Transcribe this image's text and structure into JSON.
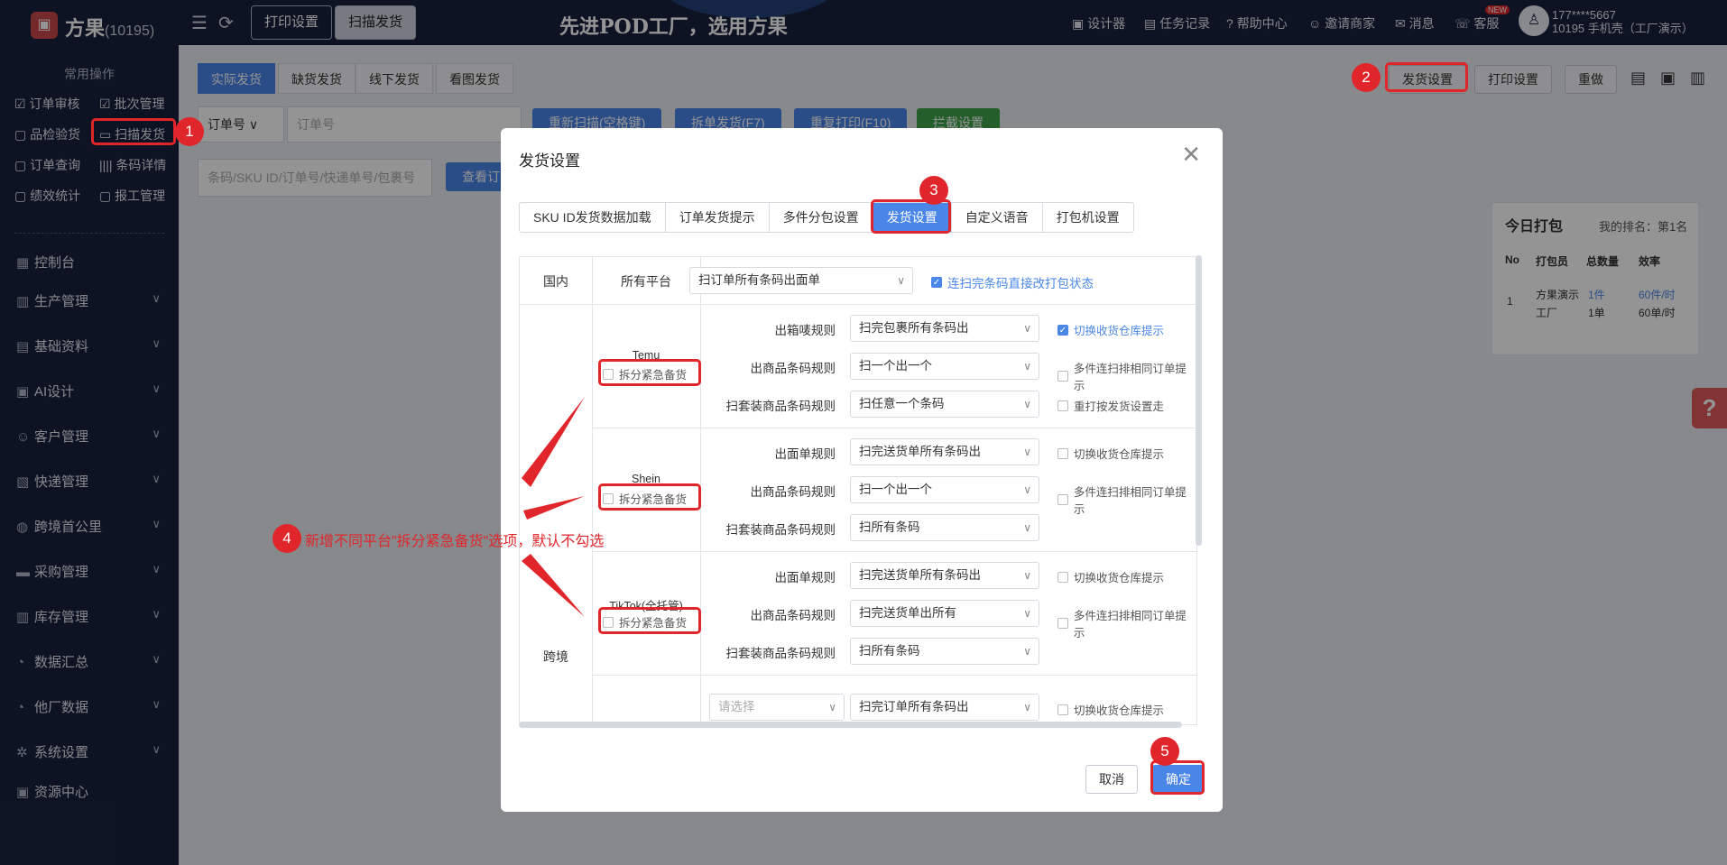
{
  "app": {
    "name": "方果",
    "id": "(10195)",
    "slogan": "先进POD工厂，选用方果"
  },
  "topbar": {
    "print_settings": "打印设置",
    "scan_ship": "扫描发货",
    "links": [
      "设计器",
      "任务记录",
      "帮助中心",
      "邀请商家",
      "消息",
      "客服"
    ],
    "new_badge": "NEW",
    "user_phone": "177****5667",
    "user_sub": "10195 手机壳（工厂演示）"
  },
  "sidebar": {
    "title": "常用操作",
    "quick": [
      "订单审核",
      "批次管理",
      "品检验货",
      "扫描发货",
      "订单查询",
      "条码详情",
      "绩效统计",
      "报工管理"
    ],
    "menu": [
      "控制台",
      "生产管理",
      "基础资料",
      "AI设计",
      "客户管理",
      "快递管理",
      "跨境首公里",
      "采购管理",
      "库存管理",
      "数据汇总",
      "他厂数据",
      "系统设置",
      "资源中心"
    ]
  },
  "subtabs": [
    "实际发货",
    "缺货发货",
    "线下发货",
    "看图发货"
  ],
  "right_buttons": [
    "发货设置",
    "打印设置",
    "重做"
  ],
  "search": {
    "order_type": "订单号",
    "order_ph": "订单号",
    "barcode_ph": "条码/SKU ID/订单号/快递单号/包裹号",
    "view_btn": "查看订"
  },
  "actions": [
    "重新扫描(空格键)",
    "拆单发货(F7)",
    "重复打印(F10)",
    "拦截设置"
  ],
  "panel": {
    "title": "今日打包",
    "rank": "我的排名：第1名",
    "headers": [
      "No",
      "打包员",
      "总数量",
      "效率"
    ],
    "row": {
      "no": "1",
      "user1": "方果演示",
      "user2": "工厂",
      "qty1": "1件",
      "qty2": "1单",
      "eff1": "60件/时",
      "eff2": "60单/时"
    }
  },
  "modal": {
    "title": "发货设置",
    "tabs": [
      "SKU ID发货数据加载",
      "订单发货提示",
      "多件分包设置",
      "发货设置",
      "自定义语音",
      "打包机设置"
    ],
    "domestic": "国内",
    "all_platforms": "所有平台",
    "domestic_select": "扫订单所有条码出面单",
    "domestic_check": "连扫完条码直接改打包状态",
    "cross": "跨境",
    "platforms": [
      {
        "name": "Temu",
        "split": "拆分紧急备货",
        "rules": [
          {
            "label": "出箱唛规则",
            "value": "扫完包裹所有条码出",
            "check": "切换收货仓库提示",
            "checked": true
          },
          {
            "label": "出商品条码规则",
            "value": "扫一个出一个",
            "check": "多件连扫排相同订单提示",
            "checked": false
          },
          {
            "label": "扫套装商品条码规则",
            "value": "扫任意一个条码",
            "check": "重打按发货设置走",
            "checked": false
          }
        ]
      },
      {
        "name": "Shein",
        "split": "拆分紧急备货",
        "rules": [
          {
            "label": "出面单规则",
            "value": "扫完送货单所有条码出",
            "check": "切换收货仓库提示",
            "checked": false
          },
          {
            "label": "出商品条码规则",
            "value": "扫一个出一个",
            "check": "多件连扫排相同订单提示",
            "checked": false
          },
          {
            "label": "扫套装商品条码规则",
            "value": "扫所有条码",
            "check": "",
            "checked": false
          }
        ]
      },
      {
        "name": "TikTok(全托管)",
        "split": "拆分紧急备货",
        "rules": [
          {
            "label": "出面单规则",
            "value": "扫完送货单所有条码出",
            "check": "切换收货仓库提示",
            "checked": false
          },
          {
            "label": "出商品条码规则",
            "value": "扫完送货单出所有",
            "check": "多件连扫排相同订单提示",
            "checked": false
          },
          {
            "label": "扫套装商品条码规则",
            "value": "扫所有条码",
            "check": "",
            "checked": false
          }
        ]
      }
    ],
    "last_row": {
      "placeholder": "请选择",
      "value": "扫完订单所有条码出",
      "check": "切换收货仓库提示"
    },
    "cancel": "取消",
    "confirm": "确定"
  },
  "annotations": {
    "n1": "1",
    "n2": "2",
    "n3": "3",
    "n4": "4",
    "n5": "5",
    "note": "新增不同平台\"拆分紧急备货\"选项，默认不勾选"
  },
  "colors": {
    "primary": "#4a86e8",
    "dark": "#17223d",
    "annot": "#e0262b"
  }
}
